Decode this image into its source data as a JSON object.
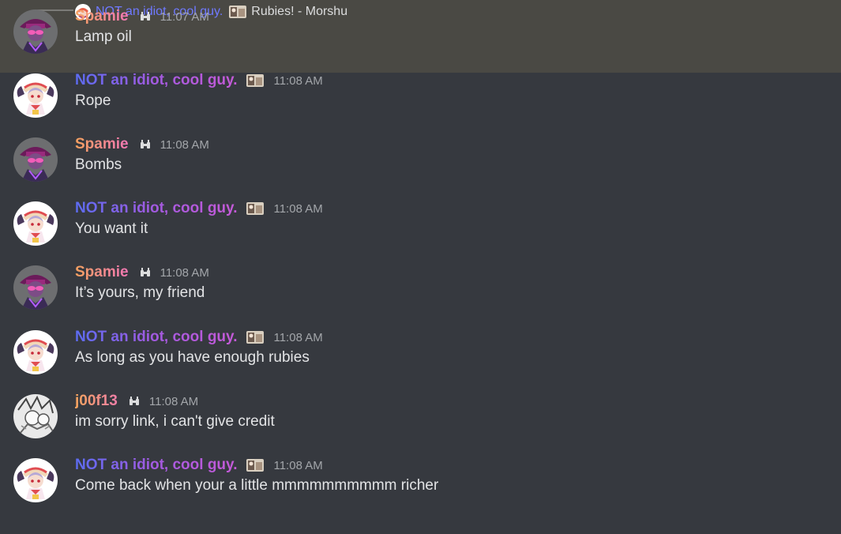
{
  "reply": {
    "author": "NOT an idiot, cool guy.",
    "text": "Rubies! - Morshu"
  },
  "messages": [
    {
      "author": "Spamie",
      "style": "spamie",
      "avatar": "spamie-avatar",
      "badge": "binoculars-icon",
      "time": "11:07 AM",
      "text": "Lamp oil",
      "highlighted": true
    },
    {
      "author": "NOT an idiot, cool guy.",
      "style": "cool",
      "avatar": "remilia-avatar",
      "badge": "picture-badge-icon",
      "time": "11:08 AM",
      "text": "Rope"
    },
    {
      "author": "Spamie",
      "style": "spamie",
      "avatar": "spamie-avatar",
      "badge": "binoculars-icon",
      "time": "11:08 AM",
      "text": "Bombs"
    },
    {
      "author": "NOT an idiot, cool guy.",
      "style": "cool",
      "avatar": "remilia-avatar",
      "badge": "picture-badge-icon",
      "time": "11:08 AM",
      "text": "You want it"
    },
    {
      "author": "Spamie",
      "style": "spamie",
      "avatar": "spamie-avatar",
      "badge": "binoculars-icon",
      "time": "11:08 AM",
      "text": "It’s yours, my friend"
    },
    {
      "author": "NOT an idiot, cool guy.",
      "style": "cool",
      "avatar": "remilia-avatar",
      "badge": "picture-badge-icon",
      "time": "11:08 AM",
      "text": "As long as you have enough rubies"
    },
    {
      "author": "j00f13",
      "style": "joof",
      "avatar": "manga-avatar",
      "badge": "binoculars-icon",
      "time": "11:08 AM",
      "text": "im sorry link, i can't give credit"
    },
    {
      "author": "NOT an idiot, cool guy.",
      "style": "cool",
      "avatar": "remilia-avatar",
      "badge": "picture-badge-icon",
      "time": "11:08 AM",
      "text": "Come back when your a little mmmmmmmmmm richer"
    }
  ],
  "colors": {
    "background": "#36393f",
    "highlight": "#4a4944",
    "timestamp": "#a3a6aa",
    "text": "#e3e4e6"
  }
}
